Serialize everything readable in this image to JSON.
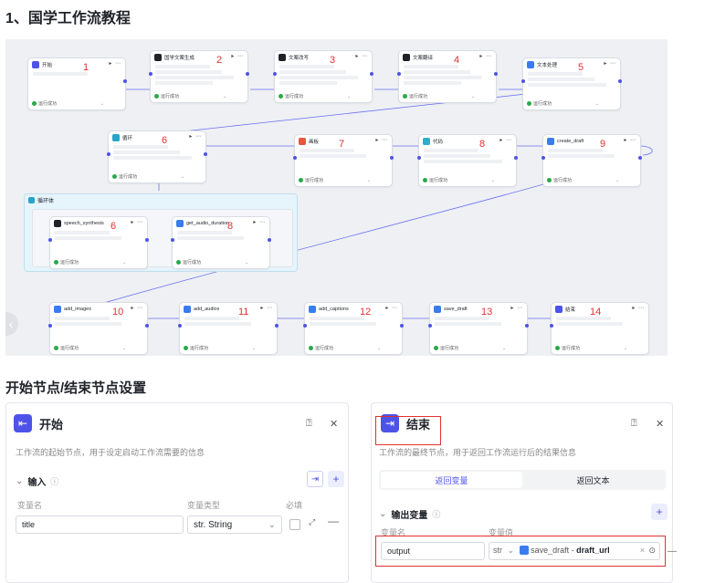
{
  "page": {
    "title": "1、国学工作流教程",
    "subtitle": "开始节点/结束节点设置"
  },
  "workflow": {
    "status_label": "运行成功",
    "nodes": [
      {
        "id": "n1",
        "name": "开始",
        "number": "1",
        "color": "#4d53e8"
      },
      {
        "id": "n2",
        "name": "国学文案生成",
        "number": "2",
        "color": "#1f2329"
      },
      {
        "id": "n3",
        "name": "文案改写",
        "number": "3",
        "color": "#1f2329"
      },
      {
        "id": "n4",
        "name": "文案翻译",
        "number": "4",
        "color": "#1f2329"
      },
      {
        "id": "n5",
        "name": "文本处理",
        "number": "5",
        "color": "#3a7bf0"
      },
      {
        "id": "n6",
        "name": "循环",
        "number": "6",
        "color": "#26a4c9"
      },
      {
        "id": "n7",
        "name": "画板",
        "number": "7",
        "color": "#e8563d"
      },
      {
        "id": "n8",
        "name": "代码",
        "number": "8",
        "color": "#2bb0c9"
      },
      {
        "id": "n9",
        "name": "create_draft",
        "number": "9",
        "color": "#3a7bf0"
      },
      {
        "id": "n6b",
        "name": "speech_synthesis",
        "number": "6",
        "color": "#1f2329"
      },
      {
        "id": "n8b",
        "name": "get_audio_duration",
        "number": "8",
        "color": "#3a7bf0"
      },
      {
        "id": "n10",
        "name": "add_images",
        "number": "10",
        "color": "#3a7bf0"
      },
      {
        "id": "n11",
        "name": "add_audios",
        "number": "11",
        "color": "#3a7bf0"
      },
      {
        "id": "n12",
        "name": "add_captions",
        "number": "12",
        "color": "#3a7bf0"
      },
      {
        "id": "n13",
        "name": "save_draft",
        "number": "13",
        "color": "#3a7bf0"
      },
      {
        "id": "n14",
        "name": "结束",
        "number": "14",
        "color": "#4d53e8"
      }
    ],
    "loop_label": "循环体"
  },
  "start_panel": {
    "title": "开始",
    "description": "工作流的起始节点，用于设定启动工作流需要的信息",
    "section": "输入",
    "col_name": "变量名",
    "col_type": "变量类型",
    "col_required": "必填",
    "var_name": "title",
    "var_type": "str. String"
  },
  "end_panel": {
    "title": "结束",
    "description": "工作流的最终节点，用于返回工作流运行后的结果信息",
    "tab_1": "返回变量",
    "tab_2": "返回文本",
    "section": "输出变量",
    "col_name": "变量名",
    "col_value": "变量值",
    "var_name": "output",
    "var_type": "str",
    "ref_node": "save_draft",
    "ref_sep": " - ",
    "ref_field": "draft_url"
  }
}
